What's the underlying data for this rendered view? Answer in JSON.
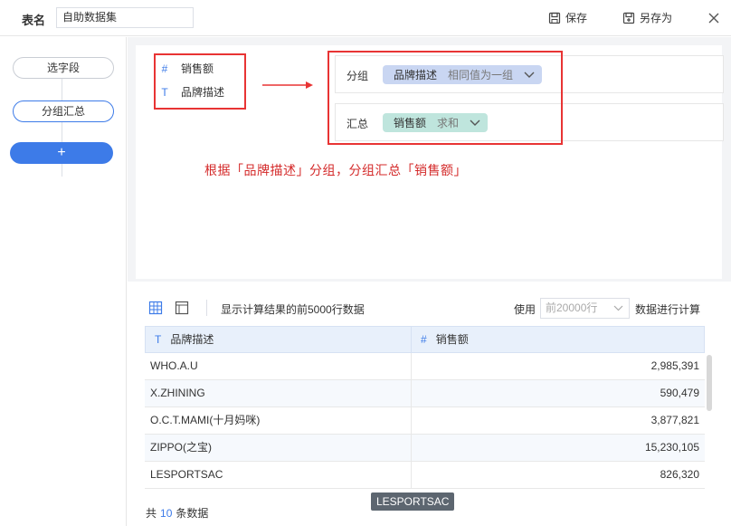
{
  "topbar": {
    "table_name_label": "表名",
    "table_name_value": "自助数据集",
    "save_label": "保存",
    "save_as_label": "另存为"
  },
  "steps": {
    "items": [
      {
        "label": "选字段"
      },
      {
        "label": "分组汇总"
      }
    ],
    "add_label": "+"
  },
  "config": {
    "fields": [
      {
        "type_icon": "#",
        "label": "销售额"
      },
      {
        "type_icon": "T",
        "label": "品牌描述"
      }
    ],
    "group_row": {
      "label": "分组",
      "field": "品牌描述",
      "option": "相同值为一组"
    },
    "summary_row": {
      "label": "汇总",
      "field": "销售额",
      "option": "求和"
    },
    "annotation": "根据「品牌描述」分组，分组汇总「销售额」"
  },
  "preview": {
    "info_text": "显示计算结果的前5000行数据",
    "use_label": "使用",
    "row_select_value": "前20000行",
    "calc_label": "数据进行计算",
    "columns": [
      {
        "type_icon": "T",
        "label": "品牌描述"
      },
      {
        "type_icon": "#",
        "label": "销售额"
      }
    ],
    "rows": [
      {
        "brand": "WHO.A.U",
        "sales": "2,985,391"
      },
      {
        "brand": "X.ZHINING",
        "sales": "590,479"
      },
      {
        "brand": "O.C.T.MAMI(十月妈咪)",
        "sales": "3,877,821"
      },
      {
        "brand": "ZIPPO(之宝)",
        "sales": "15,230,105"
      },
      {
        "brand": "LESPORTSAC",
        "sales": "826,320"
      }
    ],
    "total_prefix": "共",
    "total_count": "10",
    "total_suffix": "条数据",
    "tooltip": "LESPORTSAC"
  },
  "colors": {
    "accent": "#3d7be8",
    "annotation_red": "#e83434",
    "group_pill": "#c9d6f2",
    "summary_pill": "#bfe5dd"
  }
}
